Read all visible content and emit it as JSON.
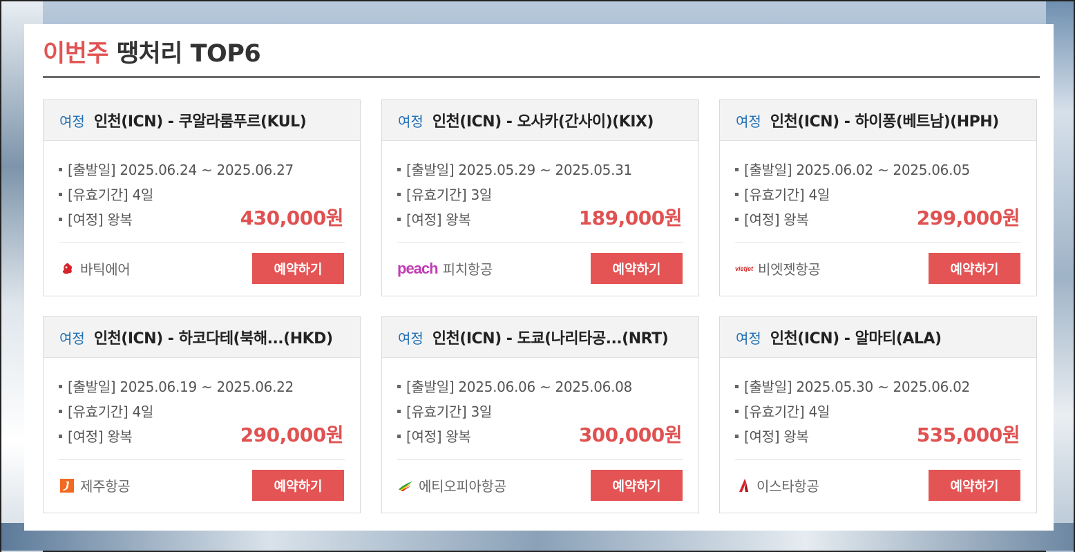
{
  "heading": {
    "accent": "이번주",
    "rest": " 땡처리 TOP6"
  },
  "labels": {
    "departure": "[출발일]",
    "validity": "[유효기간]",
    "trip": "[여정]",
    "book_button": "예약하기"
  },
  "colors": {
    "accent": "#e25454",
    "tag": "#1f6fb5",
    "button": "#e45454"
  },
  "deals": [
    {
      "tag": "여정",
      "route": "인천(ICN) - 쿠알라룸푸르(KUL)",
      "dates": "2025.06.24 ~ 2025.06.27",
      "validity": "4일",
      "trip": "왕복",
      "price": "430,000원",
      "airline": "바틱에어",
      "airline_icon": "batik-air-logo-icon"
    },
    {
      "tag": "여정",
      "route": "인천(ICN) - 오사카(간사이)(KIX)",
      "dates": "2025.05.29 ~ 2025.05.31",
      "validity": "3일",
      "trip": "왕복",
      "price": "189,000원",
      "airline": "피치항공",
      "airline_icon": "peach-logo-icon",
      "airline_logo_text": "peach"
    },
    {
      "tag": "여정",
      "route": "인천(ICN) - 하이퐁(베트남)(HPH)",
      "dates": "2025.06.02 ~ 2025.06.05",
      "validity": "4일",
      "trip": "왕복",
      "price": "299,000원",
      "airline": "비엣젯항공",
      "airline_icon": "vietjet-logo-icon",
      "airline_logo_text": "vietjet"
    },
    {
      "tag": "여정",
      "route": "인천(ICN) - 하코다테(북해...(HKD)",
      "dates": "2025.06.19 ~ 2025.06.22",
      "validity": "4일",
      "trip": "왕복",
      "price": "290,000원",
      "airline": "제주항공",
      "airline_icon": "jeju-air-logo-icon"
    },
    {
      "tag": "여정",
      "route": "인천(ICN) - 도쿄(나리타공...(NRT)",
      "dates": "2025.06.06 ~ 2025.06.08",
      "validity": "3일",
      "trip": "왕복",
      "price": "300,000원",
      "airline": "에티오피아항공",
      "airline_icon": "ethiopian-airlines-logo-icon"
    },
    {
      "tag": "여정",
      "route": "인천(ICN) - 알마티(ALA)",
      "dates": "2025.05.30 ~ 2025.06.02",
      "validity": "4일",
      "trip": "왕복",
      "price": "535,000원",
      "airline": "이스타항공",
      "airline_icon": "eastar-jet-logo-icon"
    }
  ]
}
